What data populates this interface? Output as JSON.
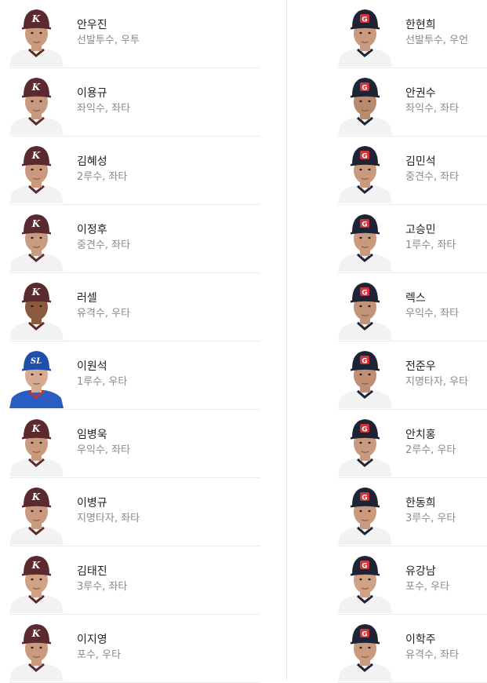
{
  "left_players": [
    {
      "name": "안우진",
      "detail": "선발투수, 우투",
      "team": "K",
      "cap": "#5b2a2e",
      "logo": "#ffffff",
      "jersey": "#f2f2f2",
      "trim": "#5b2a2e",
      "skin": "#c99a7e"
    },
    {
      "name": "이용규",
      "detail": "좌익수, 좌타",
      "team": "K",
      "cap": "#5b2a2e",
      "logo": "#ffffff",
      "jersey": "#f2f2f2",
      "trim": "#5b2a2e",
      "skin": "#c79a80"
    },
    {
      "name": "김혜성",
      "detail": "2루수, 좌타",
      "team": "K",
      "cap": "#5b2a2e",
      "logo": "#ffffff",
      "jersey": "#f2f2f2",
      "trim": "#5b2a2e",
      "skin": "#c99a7e"
    },
    {
      "name": "이정후",
      "detail": "중견수, 좌타",
      "team": "K",
      "cap": "#5b2a2e",
      "logo": "#ffffff",
      "jersey": "#f2f2f2",
      "trim": "#5b2a2e",
      "skin": "#c89c80"
    },
    {
      "name": "러셀",
      "detail": "유격수, 우타",
      "team": "K",
      "cap": "#5b2a2e",
      "logo": "#ffffff",
      "jersey": "#f2f2f2",
      "trim": "#5b2a2e",
      "skin": "#8a5a3c"
    },
    {
      "name": "이원석",
      "detail": "1루수, 우타",
      "team": "SL",
      "cap": "#1f4fa8",
      "logo": "#ffffff",
      "jersey": "#2a5cc4",
      "trim": "#c0392b",
      "skin": "#d7ab90"
    },
    {
      "name": "임병욱",
      "detail": "우익수, 좌타",
      "team": "K",
      "cap": "#5b2a2e",
      "logo": "#ffffff",
      "jersey": "#f2f2f2",
      "trim": "#5b2a2e",
      "skin": "#c99a7e"
    },
    {
      "name": "이병규",
      "detail": "지명타자, 좌타",
      "team": "K",
      "cap": "#5b2a2e",
      "logo": "#ffffff",
      "jersey": "#f2f2f2",
      "trim": "#5b2a2e",
      "skin": "#c99a7e"
    },
    {
      "name": "김태진",
      "detail": "3루수, 좌타",
      "team": "K",
      "cap": "#5b2a2e",
      "logo": "#ffffff",
      "jersey": "#f2f2f2",
      "trim": "#5b2a2e",
      "skin": "#cfa286"
    },
    {
      "name": "이지영",
      "detail": "포수, 우타",
      "team": "K",
      "cap": "#5b2a2e",
      "logo": "#ffffff",
      "jersey": "#f2f2f2",
      "trim": "#5b2a2e",
      "skin": "#c99a7e"
    }
  ],
  "right_players": [
    {
      "name": "한현희",
      "detail": "선발투수, 우언",
      "team": "G",
      "cap": "#1e2336",
      "logo": "#d0343a",
      "jersey": "#f2f2f2",
      "trim": "#1e2336",
      "skin": "#c99a7e"
    },
    {
      "name": "안권수",
      "detail": "좌익수, 좌타",
      "team": "G",
      "cap": "#1e2336",
      "logo": "#d0343a",
      "jersey": "#f2f2f2",
      "trim": "#1e2336",
      "skin": "#b98a6c"
    },
    {
      "name": "김민석",
      "detail": "중견수, 좌타",
      "team": "G",
      "cap": "#1e2336",
      "logo": "#d0343a",
      "jersey": "#f2f2f2",
      "trim": "#1e2336",
      "skin": "#c99a7e"
    },
    {
      "name": "고승민",
      "detail": "1루수, 좌타",
      "team": "G",
      "cap": "#1e2336",
      "logo": "#d0343a",
      "jersey": "#f2f2f2",
      "trim": "#1e2336",
      "skin": "#c99a7e"
    },
    {
      "name": "렉스",
      "detail": "우익수, 좌타",
      "team": "G",
      "cap": "#1e2336",
      "logo": "#d0343a",
      "jersey": "#f2f2f2",
      "trim": "#1e2336",
      "skin": "#c39478"
    },
    {
      "name": "전준우",
      "detail": "지명타자, 우타",
      "team": "G",
      "cap": "#1e2336",
      "logo": "#d0343a",
      "jersey": "#f2f2f2",
      "trim": "#1e2336",
      "skin": "#bf8f72"
    },
    {
      "name": "안치홍",
      "detail": "2루수, 우타",
      "team": "G",
      "cap": "#1e2336",
      "logo": "#d0343a",
      "jersey": "#f2f2f2",
      "trim": "#1e2336",
      "skin": "#c99a7e"
    },
    {
      "name": "한동희",
      "detail": "3루수, 우타",
      "team": "G",
      "cap": "#1e2336",
      "logo": "#d0343a",
      "jersey": "#f2f2f2",
      "trim": "#1e2336",
      "skin": "#c99a7e"
    },
    {
      "name": "유강남",
      "detail": "포수, 우타",
      "team": "G",
      "cap": "#1e2336",
      "logo": "#d0343a",
      "jersey": "#f2f2f2",
      "trim": "#1e2336",
      "skin": "#cfa286"
    },
    {
      "name": "이학주",
      "detail": "유격수, 좌타",
      "team": "G",
      "cap": "#1e2336",
      "logo": "#d0343a",
      "jersey": "#f2f2f2",
      "trim": "#1e2336",
      "skin": "#c99a7e"
    }
  ]
}
